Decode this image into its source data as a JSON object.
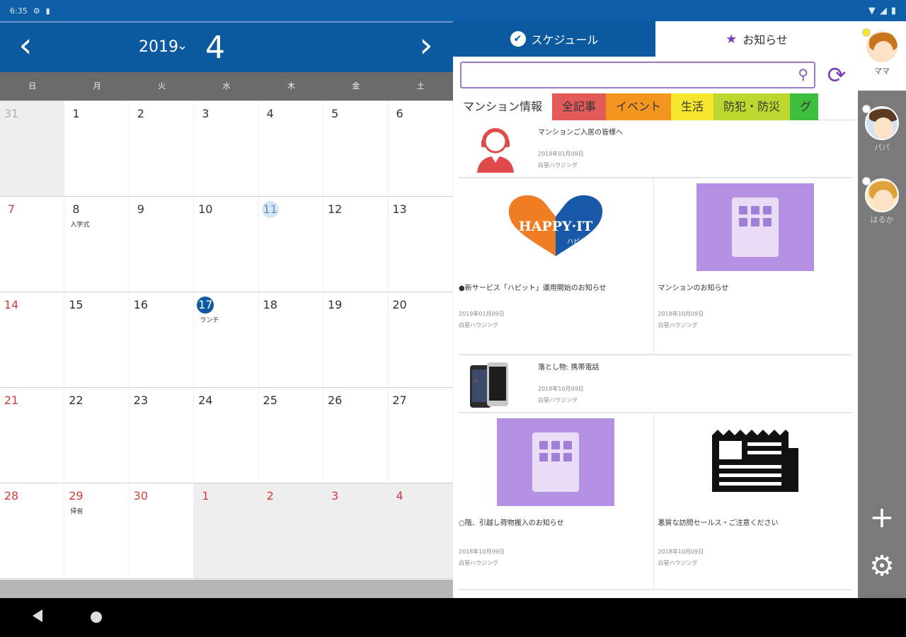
{
  "status": {
    "time": "6:35",
    "icons": [
      "settings-icon",
      "sim-icon",
      "wifi-icon",
      "signal-icon",
      "battery-icon"
    ]
  },
  "calendar": {
    "year": "2019",
    "month": "4",
    "weekdays": [
      "日",
      "月",
      "火",
      "水",
      "木",
      "金",
      "土"
    ],
    "weeks": [
      [
        {
          "d": "31",
          "t": "grey",
          "o": true
        },
        {
          "d": "1"
        },
        {
          "d": "2"
        },
        {
          "d": "3"
        },
        {
          "d": "4"
        },
        {
          "d": "5"
        },
        {
          "d": "6"
        }
      ],
      [
        {
          "d": "7",
          "t": "sun"
        },
        {
          "d": "8",
          "e": "入学式"
        },
        {
          "d": "9"
        },
        {
          "d": "10"
        },
        {
          "d": "11",
          "t": "today"
        },
        {
          "d": "12"
        },
        {
          "d": "13"
        }
      ],
      [
        {
          "d": "14",
          "t": "sun"
        },
        {
          "d": "15"
        },
        {
          "d": "16"
        },
        {
          "d": "17",
          "t": "selected",
          "e": "ランチ"
        },
        {
          "d": "18"
        },
        {
          "d": "19"
        },
        {
          "d": "20"
        }
      ],
      [
        {
          "d": "21",
          "t": "sun"
        },
        {
          "d": "22"
        },
        {
          "d": "23"
        },
        {
          "d": "24"
        },
        {
          "d": "25"
        },
        {
          "d": "26"
        },
        {
          "d": "27"
        }
      ],
      [
        {
          "d": "28",
          "t": "sun"
        },
        {
          "d": "29",
          "t": "holiday",
          "e": "帰省"
        },
        {
          "d": "30",
          "t": "holiday"
        },
        {
          "d": "1",
          "t": "holiday",
          "o": true
        },
        {
          "d": "2",
          "t": "holiday",
          "o": true
        },
        {
          "d": "3",
          "t": "holiday",
          "o": true
        },
        {
          "d": "4",
          "t": "holiday",
          "o": true
        }
      ]
    ]
  },
  "panel": {
    "tabs": {
      "schedule": "スケジュール",
      "notice": "お知らせ"
    },
    "search": {
      "placeholder": ""
    },
    "categories": [
      "マンション情報",
      "全記事",
      "イベント",
      "生活",
      "防犯・防災",
      "グ"
    ],
    "articles": {
      "a1": {
        "title": "マンションご入居の皆様へ",
        "date": "2019年01月09日",
        "author": "白堊ハウジング"
      },
      "a2": {
        "title": "●新サービス「ハピット」運用開始のお知らせ",
        "date": "2019年01月09日",
        "author": "白堊ハウジング",
        "logo_main": "HAPPY·IT",
        "logo_sub": "ハピット"
      },
      "a3": {
        "title": "マンションのお知らせ",
        "date": "2018年10月09日",
        "author": "白堊ハウジング"
      },
      "a4": {
        "title": "落とし物: 携帯電話",
        "date": "2018年10月09日",
        "author": "白堊ハウジング"
      },
      "a5": {
        "title": "○階、引越し荷物搬入のお知らせ",
        "date": "2018年10月09日",
        "author": "白堊ハウジング"
      },
      "a6": {
        "title": "悪質な訪問セールス・ご注意ください",
        "date": "2018年10月09日",
        "author": "白堊ハウジング"
      }
    }
  },
  "users": [
    {
      "name": "ママ"
    },
    {
      "name": "パパ"
    },
    {
      "name": "はるか"
    }
  ],
  "colors": {
    "primary": "#0c5aa0",
    "accent": "#7b3fb5",
    "sunday": "#d23b3b"
  }
}
